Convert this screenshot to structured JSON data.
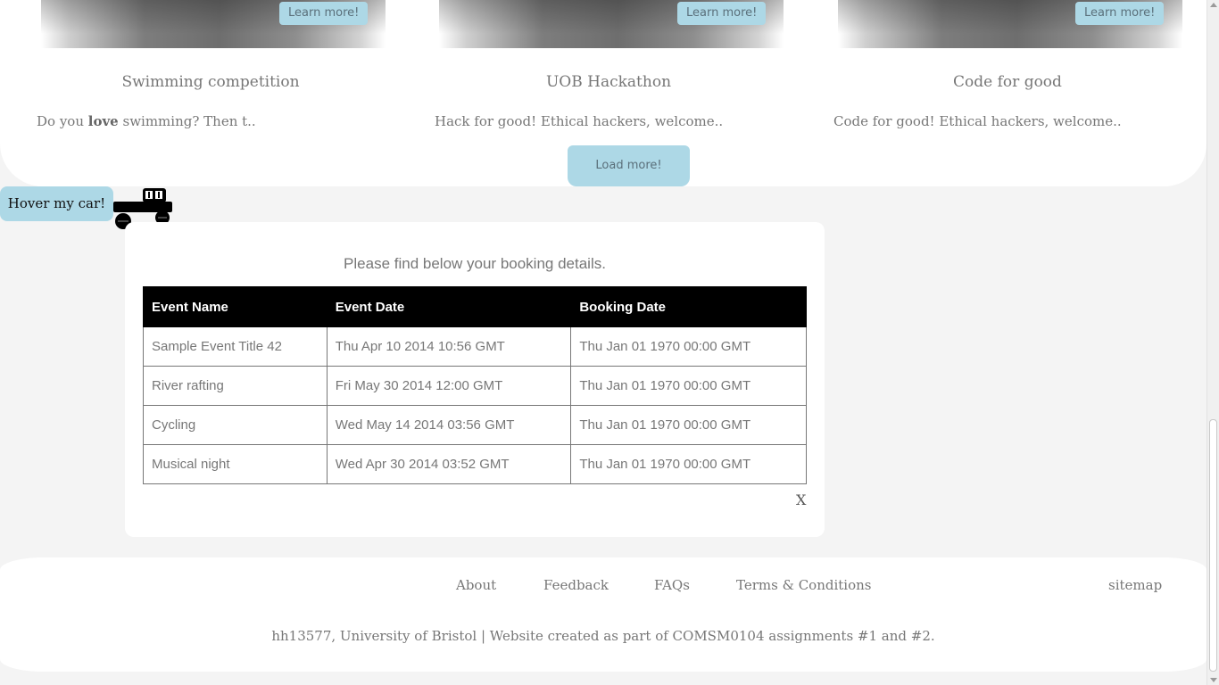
{
  "events": {
    "cards": [
      {
        "learn_more": "Learn more!",
        "title": "Swimming competition",
        "desc_prefix": "Do you ",
        "desc_bold": "love",
        "desc_suffix": " swimming? Then t.."
      },
      {
        "learn_more": "Learn more!",
        "title": "UOB Hackathon",
        "desc": "Hack for good! Ethical hackers, welcome.."
      },
      {
        "learn_more": "Learn more!",
        "title": "Code for good",
        "desc": "Code for good! Ethical hackers, welcome.."
      }
    ],
    "load_more": "Load more!"
  },
  "hover_car": {
    "label": "Hover my car!",
    "icon": "car-icon"
  },
  "booking": {
    "heading": "Please find below your booking details.",
    "columns": [
      "Event Name",
      "Event Date",
      "Booking Date"
    ],
    "rows": [
      [
        "Sample Event Title 42",
        "Thu Apr 10 2014 10:56 GMT",
        "Thu Jan 01 1970 00:00 GMT"
      ],
      [
        "River rafting",
        "Fri May 30 2014 12:00 GMT",
        "Thu Jan 01 1970 00:00 GMT"
      ],
      [
        "Cycling",
        "Wed May 14 2014 03:56 GMT",
        "Thu Jan 01 1970 00:00 GMT"
      ],
      [
        "Musical night",
        "Wed Apr 30 2014 03:52 GMT",
        "Thu Jan 01 1970 00:00 GMT"
      ]
    ],
    "close": "X"
  },
  "footer": {
    "links": [
      "About",
      "Feedback",
      "FAQs",
      "Terms & Conditions"
    ],
    "sitemap": "sitemap",
    "credit": "hh13577, University of Bristol | Website created as part of COMSM0104 assignments #1 and #2."
  },
  "colors": {
    "accent": "#add8e6",
    "table_header_bg": "#000000",
    "page_bg": "#f4f4f4",
    "panel_bg": "#ffffff",
    "text": "#777777"
  }
}
